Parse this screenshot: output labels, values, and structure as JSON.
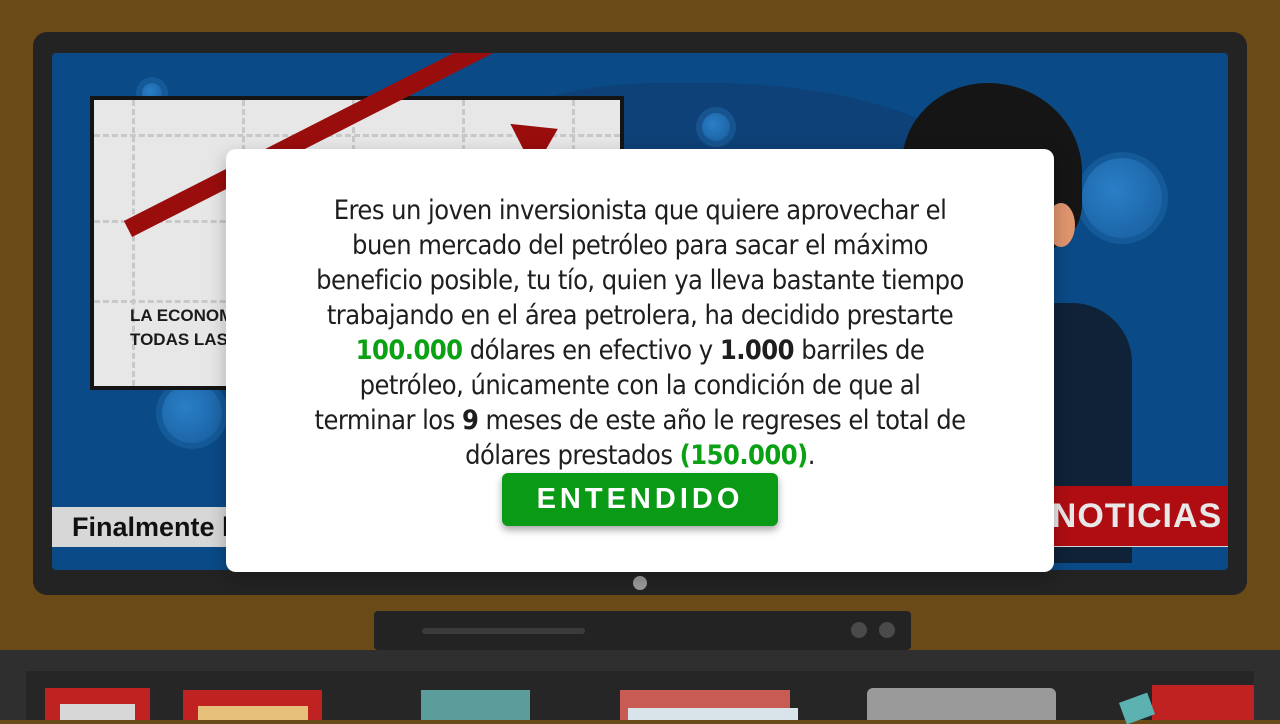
{
  "background_scene": {
    "chart_caption_line1": "LA ECONOM",
    "chart_caption_line2": "TODAS LAS",
    "ticker_text": "Finalmente la",
    "news_label": "NOTICIAS"
  },
  "modal": {
    "text_parts": {
      "p1": "Eres un joven inversionista que quiere aprovechar el buen mercado del petróleo para sacar el máximo beneficio posible, tu tío, quien ya lleva bastante tiempo trabajando en el área petrolera, ha decidido prestarte ",
      "amount_dollars": "100.000",
      "p2": " dólares en efectivo y ",
      "amount_barrels": "1.000",
      "p3": " barriles de petróleo, únicamente con la condición de que al terminar los ",
      "months": "9",
      "p4": " meses de este año le regreses el total de dólares prestados ",
      "total_due": "(150.000)",
      "p5": "."
    },
    "button_label": "ENTENDIDO"
  },
  "colors": {
    "accent_green": "#0aa114",
    "button_green": "#0a9a16",
    "news_red": "#b00d12",
    "screen_blue": "#0a4a86",
    "wall_brown": "#6a4a16"
  }
}
